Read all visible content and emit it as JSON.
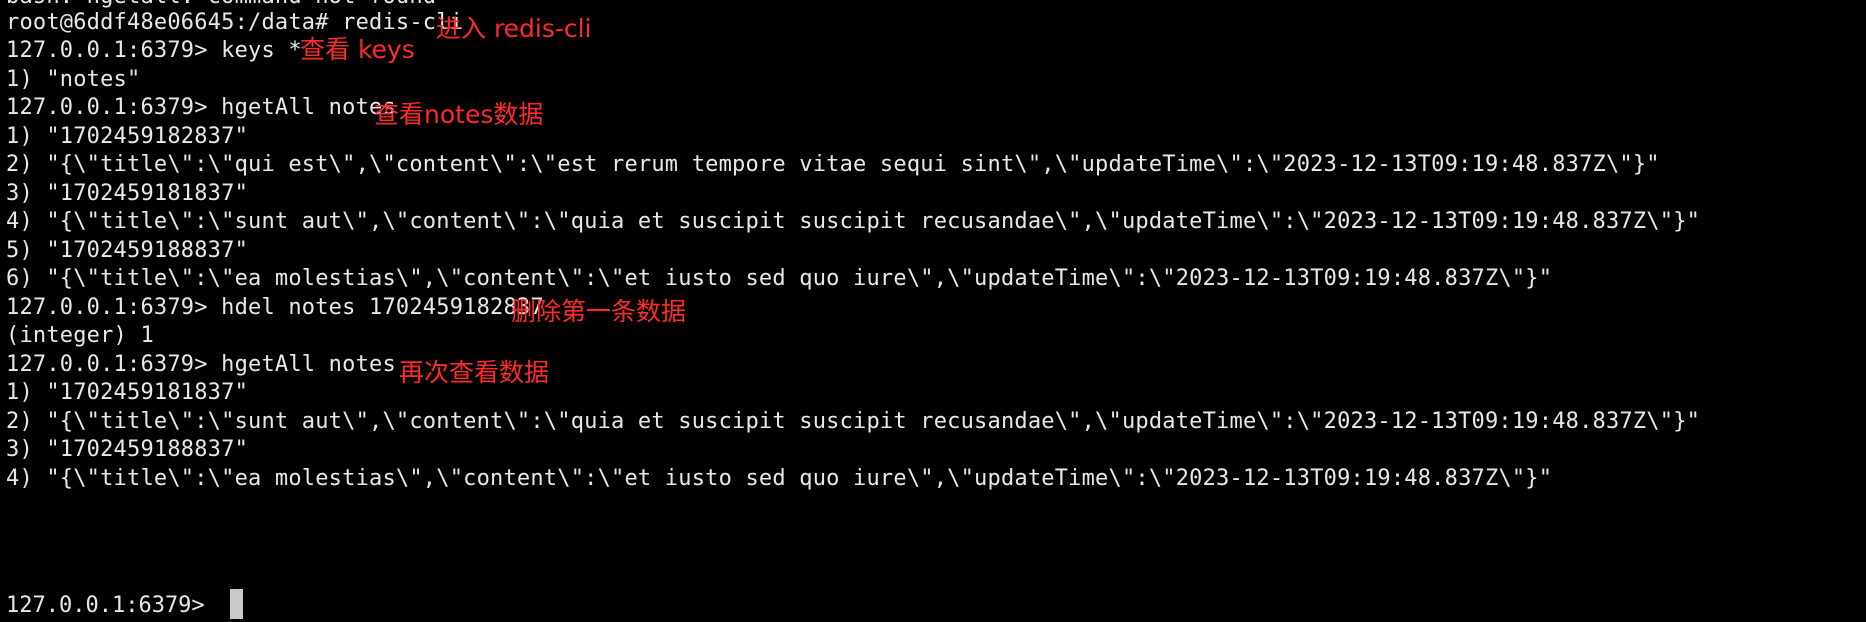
{
  "terminal": {
    "lines": [
      "bash: hgetall: command not found",
      "root@6ddf48e06645:/data# redis-cli",
      "127.0.0.1:6379> keys *",
      "1) \"notes\"",
      "127.0.0.1:6379> hgetAll notes",
      "1) \"1702459182837\"",
      "2) \"{\\\"title\\\":\\\"qui est\\\",\\\"content\\\":\\\"est rerum tempore vitae sequi sint\\\",\\\"updateTime\\\":\\\"2023-12-13T09:19:48.837Z\\\"}\"",
      "3) \"1702459181837\"",
      "4) \"{\\\"title\\\":\\\"sunt aut\\\",\\\"content\\\":\\\"quia et suscipit suscipit recusandae\\\",\\\"updateTime\\\":\\\"2023-12-13T09:19:48.837Z\\\"}\"",
      "5) \"1702459188837\"",
      "6) \"{\\\"title\\\":\\\"ea molestias\\\",\\\"content\\\":\\\"et iusto sed quo iure\\\",\\\"updateTime\\\":\\\"2023-12-13T09:19:48.837Z\\\"}\"",
      "127.0.0.1:6379> hdel notes 1702459182837",
      "(integer) 1",
      "127.0.0.1:6379> hgetAll notes",
      "1) \"1702459181837\"",
      "2) \"{\\\"title\\\":\\\"sunt aut\\\",\\\"content\\\":\\\"quia et suscipit suscipit recusandae\\\",\\\"updateTime\\\":\\\"2023-12-13T09:19:48.837Z\\\"}\"",
      "3) \"1702459188837\"",
      "4) \"{\\\"title\\\":\\\"ea molestias\\\",\\\"content\\\":\\\"et iusto sed quo iure\\\",\\\"updateTime\\\":\\\"2023-12-13T09:19:48.837Z\\\"}\""
    ],
    "current_prompt": "127.0.0.1:6379> "
  },
  "annotations": {
    "enter_cli": "进入 redis-cli",
    "view_keys": "查看 keys",
    "view_notes": "查看notes数据",
    "delete_first": "删除第一条数据",
    "view_again": "再次查看数据"
  },
  "colors": {
    "background": "#000000",
    "text": "#e8e8e8",
    "annotation": "#ff2a2a",
    "cursor": "#c9c9c9"
  }
}
